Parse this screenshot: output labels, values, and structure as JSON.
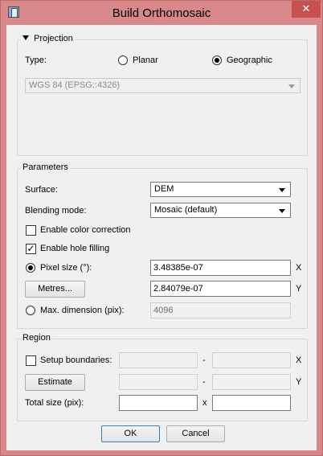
{
  "window": {
    "title": "Build Orthomosaic",
    "close_label": "✕"
  },
  "projection": {
    "title": "Projection",
    "type_label": "Type:",
    "planar_label": "Planar",
    "geographic_label": "Geographic",
    "selected_type": "Geographic",
    "crs_value": "WGS 84 (EPSG::4326)"
  },
  "parameters": {
    "title": "Parameters",
    "surface_label": "Surface:",
    "surface_value": "DEM",
    "blending_label": "Blending mode:",
    "blending_value": "Mosaic (default)",
    "color_correction_label": "Enable color correction",
    "color_correction_checked": false,
    "hole_filling_label": "Enable hole filling",
    "hole_filling_checked": true,
    "pixel_size_label": "Pixel size (°):",
    "pixel_size_x": "3.48385e-07",
    "pixel_size_y": "2.84079e-07",
    "x_label": "X",
    "y_label": "Y",
    "metres_button": "Metres...",
    "max_dimension_label": "Max. dimension (pix):",
    "max_dimension_value": "4096"
  },
  "region": {
    "title": "Region",
    "setup_boundaries_label": "Setup boundaries:",
    "estimate_button": "Estimate",
    "dash": "-",
    "x_label": "X",
    "y_label": "Y",
    "total_size_label": "Total size (pix):",
    "total_x_sep": "x"
  },
  "buttons": {
    "ok": "OK",
    "cancel": "Cancel"
  },
  "colors": {
    "frame": "#d9888a",
    "close_button": "#c75050",
    "client": "#f0f0f0"
  }
}
